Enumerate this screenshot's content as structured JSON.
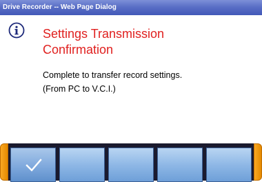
{
  "window": {
    "title": "Drive Recorder -- Web Page Dialog"
  },
  "dialog": {
    "icon": "info-icon",
    "heading": "Settings Transmission\nConfirmation",
    "message": "Complete to transfer record settings.\n(From PC to V.C.I.)",
    "colors": {
      "heading": "#e0201f",
      "titlebar": "#5a6fc6",
      "button": "#8fb8e6",
      "bar_end": "#f9a823"
    }
  },
  "button_bar": {
    "buttons": [
      {
        "icon": "checkmark-icon",
        "label": ""
      },
      {
        "icon": "",
        "label": ""
      },
      {
        "icon": "",
        "label": ""
      },
      {
        "icon": "",
        "label": ""
      },
      {
        "icon": "",
        "label": ""
      }
    ]
  }
}
